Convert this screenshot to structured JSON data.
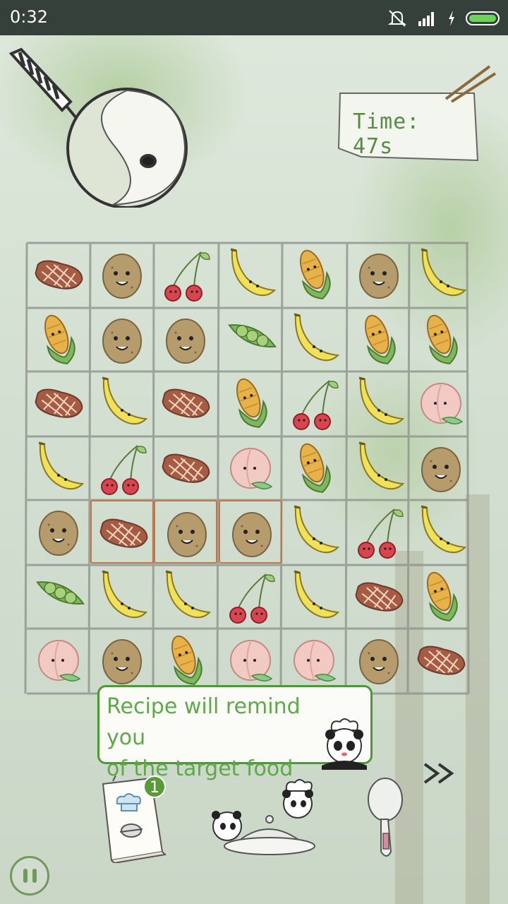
{
  "status_bar": {
    "time": "0:32"
  },
  "timer": {
    "label": "Time: 47s"
  },
  "board": {
    "rows": [
      [
        "steak",
        "potato",
        "cherry",
        "banana",
        "corn",
        "potato",
        "banana"
      ],
      [
        "corn",
        "potato",
        "potato",
        "peas",
        "banana",
        "corn",
        "corn"
      ],
      [
        "steak",
        "banana",
        "steak",
        "corn",
        "cherry",
        "banana",
        "peach"
      ],
      [
        "banana",
        "cherry",
        "steak",
        "peach",
        "corn",
        "banana",
        "potato"
      ],
      [
        "potato",
        "steak",
        "potato",
        "potato",
        "banana",
        "cherry",
        "banana"
      ],
      [
        "peas",
        "banana",
        "banana",
        "cherry",
        "banana",
        "steak",
        "corn"
      ],
      [
        "peach",
        "potato",
        "corn",
        "peach",
        "peach",
        "potato",
        "steak"
      ]
    ],
    "selected": [
      [
        4,
        1
      ],
      [
        4,
        2
      ],
      [
        4,
        3
      ]
    ]
  },
  "hint": {
    "text_line1": "Recipe will remind you",
    "text_line2": "of the target food"
  },
  "recipe_book": {
    "badge": "1",
    "icon": "recipe-book-icon"
  },
  "controls": {
    "skip_label": ">>",
    "pause_icon": "pause-icon",
    "spoon_icon": "spoon-icon"
  },
  "colors": {
    "accent": "#5b9a3a",
    "select_border": "#c0784a",
    "hint_text": "#5fa84a"
  }
}
